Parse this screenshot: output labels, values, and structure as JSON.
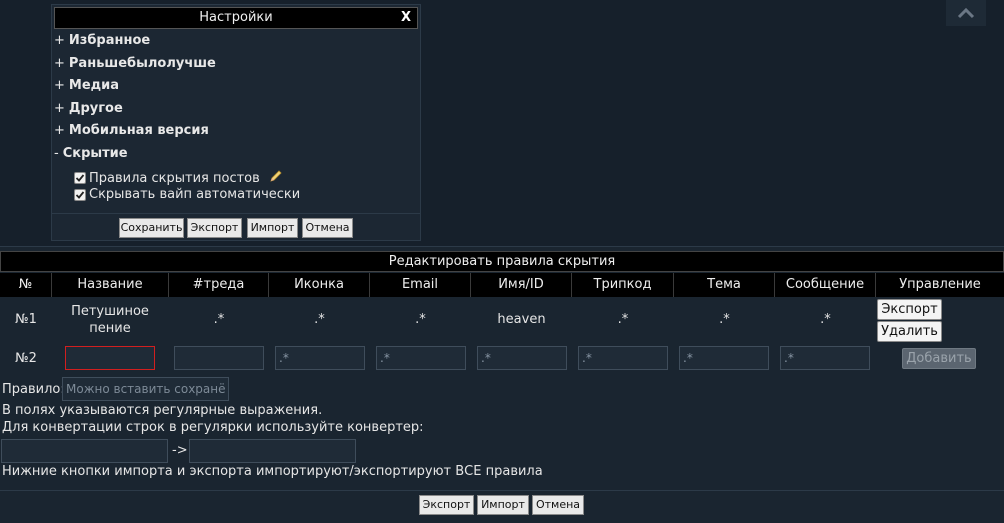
{
  "scroll_top_icon": "chevron-up-icon",
  "settings": {
    "title": "Настройки",
    "close_label": "X",
    "sections": [
      {
        "sign": "+",
        "label": "Избранное"
      },
      {
        "sign": "+",
        "label": "Раньшебылолучше"
      },
      {
        "sign": "+",
        "label": "Медиа"
      },
      {
        "sign": "+",
        "label": "Другое"
      },
      {
        "sign": "+",
        "label": "Мобильная версия"
      },
      {
        "sign": "-",
        "label": "Скрытие"
      }
    ],
    "options": [
      {
        "label": "Правила скрытия постов",
        "checked": true,
        "icon": "pencil-icon"
      },
      {
        "label": "Скрывать вайп автоматически",
        "checked": true
      }
    ],
    "buttons": {
      "save": "Сохранить",
      "export": "Экспорт",
      "import": "Импорт",
      "cancel": "Отмена"
    }
  },
  "editor": {
    "title": "Редактировать правила скрытия",
    "columns": [
      "№",
      "Название",
      "#треда",
      "Иконка",
      "Email",
      "Имя/ID",
      "Трипкод",
      "Тема",
      "Сообщение",
      "Управление"
    ],
    "rows": [
      {
        "num": "№1",
        "name": "Петушиное пение",
        "thread": ".*",
        "icon": ".*",
        "email": ".*",
        "name_id": "heaven",
        "tripcode": ".*",
        "subject": ".*",
        "message": ".*",
        "export_label": "Экспорт",
        "delete_label": "Удалить"
      }
    ],
    "new_row": {
      "num": "№2",
      "name_value": "",
      "thread_value": "",
      "placeholder": ".*",
      "add_label": "Добавить"
    },
    "rule_label": "Правило:",
    "rule_placeholder": "Можно вставить сохранё",
    "help_line1": "В полях указываются регулярные выражения.",
    "help_line2": "Для конвертации строк в регулярки используйте конвертер:",
    "converter_arrow": "->",
    "help_line3": "Нижние кнопки импорта и экспорта импортируют/экспортируют ВСЕ правила",
    "buttons": {
      "export": "Экспорт",
      "import": "Импорт",
      "cancel": "Отмена"
    }
  },
  "colors": {
    "background": "#16202b",
    "header_bg": "#000000",
    "error_border": "#d21f1f"
  }
}
